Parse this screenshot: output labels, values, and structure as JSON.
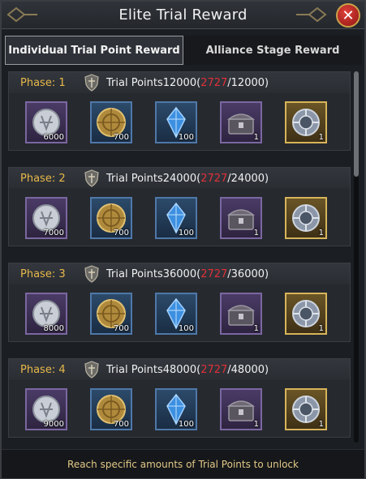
{
  "window": {
    "title": "Elite Trial Reward",
    "close_label": "✕"
  },
  "tabs": [
    {
      "label": "Individual Trial Point Reward",
      "active": true
    },
    {
      "label": "Alliance Stage Reward",
      "active": false
    }
  ],
  "phases": [
    {
      "label": "Phase: 1",
      "points_prefix": "Trial Points12000(",
      "current": "2727",
      "target_suffix": "/12000)",
      "rewards": [
        {
          "icon": "silver-coin-icon",
          "frame": "purple",
          "qty": "6000"
        },
        {
          "icon": "gold-shield-icon",
          "frame": "blue",
          "qty": "700"
        },
        {
          "icon": "blue-crystal-icon",
          "frame": "blue",
          "qty": "100"
        },
        {
          "icon": "treasure-chest-icon",
          "frame": "purple",
          "qty": "1"
        },
        {
          "icon": "steel-gear-emblem-icon",
          "frame": "gold",
          "qty": "1"
        }
      ]
    },
    {
      "label": "Phase: 2",
      "points_prefix": "Trial Points24000(",
      "current": "2727",
      "target_suffix": "/24000)",
      "rewards": [
        {
          "icon": "silver-coin-icon",
          "frame": "purple",
          "qty": "7000"
        },
        {
          "icon": "gold-shield-icon",
          "frame": "blue",
          "qty": "700"
        },
        {
          "icon": "blue-crystal-icon",
          "frame": "blue",
          "qty": "100"
        },
        {
          "icon": "treasure-chest-icon",
          "frame": "purple",
          "qty": "1"
        },
        {
          "icon": "steel-gear-emblem-icon",
          "frame": "gold",
          "qty": "1"
        }
      ]
    },
    {
      "label": "Phase: 3",
      "points_prefix": "Trial Points36000(",
      "current": "2727",
      "target_suffix": "/36000)",
      "rewards": [
        {
          "icon": "silver-coin-icon",
          "frame": "purple",
          "qty": "8000"
        },
        {
          "icon": "gold-shield-icon",
          "frame": "blue",
          "qty": "700"
        },
        {
          "icon": "blue-crystal-icon",
          "frame": "blue",
          "qty": "100"
        },
        {
          "icon": "treasure-chest-icon",
          "frame": "purple",
          "qty": "1"
        },
        {
          "icon": "steel-gear-emblem-icon",
          "frame": "gold",
          "qty": "1"
        }
      ]
    },
    {
      "label": "Phase: 4",
      "points_prefix": "Trial Points48000(",
      "current": "2727",
      "target_suffix": "/48000)",
      "rewards": [
        {
          "icon": "silver-coin-icon",
          "frame": "purple",
          "qty": "9000"
        },
        {
          "icon": "gold-shield-icon",
          "frame": "blue",
          "qty": "700"
        },
        {
          "icon": "blue-crystal-icon",
          "frame": "blue",
          "qty": "100"
        },
        {
          "icon": "treasure-chest-icon",
          "frame": "purple",
          "qty": "1"
        },
        {
          "icon": "steel-gear-emblem-icon",
          "frame": "gold",
          "qty": "1"
        }
      ]
    }
  ],
  "footer": {
    "hint": "Reach specific amounts of Trial Points to unlock"
  },
  "colors": {
    "phase_label": "#e8b84a",
    "current_points": "#e0303a",
    "footer_text": "#e2c887"
  }
}
